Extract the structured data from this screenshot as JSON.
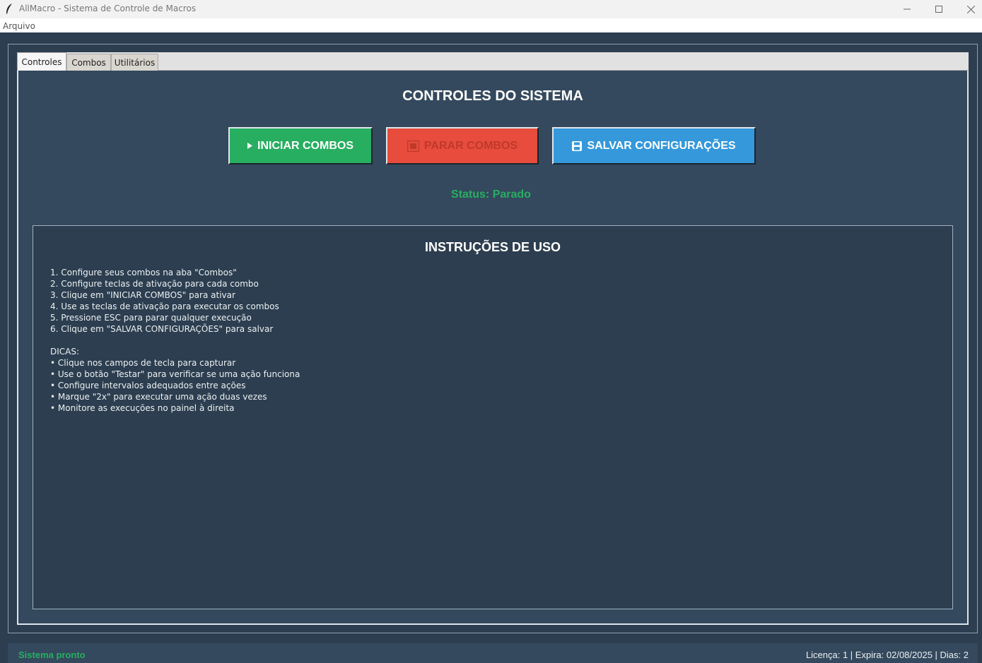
{
  "window": {
    "title": "AllMacro - Sistema de Controle de Macros"
  },
  "menubar": {
    "items": [
      "Arquivo"
    ]
  },
  "tabs": [
    {
      "label": "Controles",
      "active": true
    },
    {
      "label": "Combos",
      "active": false
    },
    {
      "label": "Utilitários",
      "active": false
    }
  ],
  "controls": {
    "title": "CONTROLES DO SISTEMA",
    "start_button": "INICIAR COMBOS",
    "stop_button": "PARAR COMBOS",
    "save_button": "SALVAR CONFIGURAÇÕES",
    "status": "Status: Parado"
  },
  "instructions": {
    "title": "INSTRUÇÕES DE USO",
    "steps": [
      "1. Configure seus combos na aba \"Combos\"",
      "2. Configure teclas de ativação para cada combo",
      "3. Clique em \"INICIAR COMBOS\" para ativar",
      "4. Use as teclas de ativação para executar os combos",
      "5. Pressione ESC para parar qualquer execução",
      "6. Clique em \"SALVAR CONFIGURAÇÕES\" para salvar"
    ],
    "tips_heading": "DICAS:",
    "tips": [
      "• Clique nos campos de tecla para capturar",
      "• Use o botão \"Testar\" para verificar se uma ação funciona",
      "• Configure intervalos adequados entre ações",
      "• Marque \"2x\" para executar uma ação duas vezes",
      "• Monitore as execuções no painel à direita"
    ]
  },
  "statusbar": {
    "left": "Sistema pronto",
    "right": "Licença: 1 | Expira: 02/08/2025 | Dias: 2"
  },
  "colors": {
    "background": "#2c3e50",
    "panel": "#34495e",
    "start": "#27ae60",
    "stop": "#e74c3c",
    "save": "#3498db",
    "status_ok": "#27ae60"
  }
}
